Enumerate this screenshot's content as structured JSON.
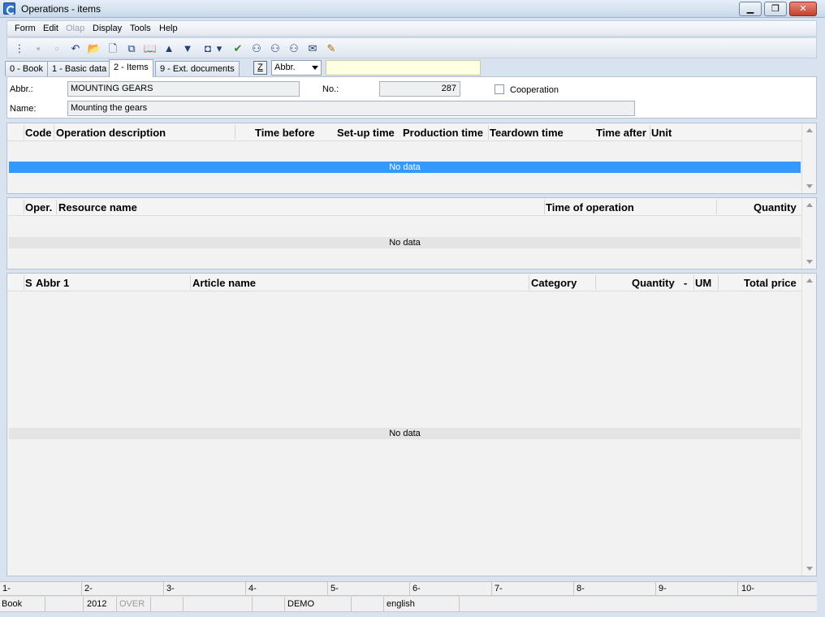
{
  "window": {
    "title": "Operations - items",
    "min": "▁",
    "max": "❐",
    "close": "✕"
  },
  "menu": [
    {
      "label": "Form",
      "disabled": false
    },
    {
      "label": "Edit",
      "disabled": false
    },
    {
      "label": "Olap",
      "disabled": true
    },
    {
      "label": "Display",
      "disabled": false
    },
    {
      "label": "Tools",
      "disabled": false
    },
    {
      "label": "Help",
      "disabled": false
    }
  ],
  "toolbar": [
    {
      "icon": "tree-icon",
      "glyph": "⋮"
    },
    {
      "icon": "save-icon",
      "glyph": "▪",
      "disabled": true
    },
    {
      "icon": "save-as-icon",
      "glyph": "▫",
      "disabled": true
    },
    {
      "icon": "undo-icon",
      "glyph": "↶"
    },
    {
      "icon": "open-folder-icon",
      "glyph": "📂"
    },
    {
      "icon": "new-document-icon",
      "glyph": "🗋"
    },
    {
      "icon": "copy-icon",
      "glyph": "⧉"
    },
    {
      "icon": "book-icon",
      "glyph": "📖"
    },
    {
      "icon": "arrow-up-icon",
      "glyph": "▲"
    },
    {
      "icon": "arrow-down-icon",
      "glyph": "▼"
    },
    {
      "icon": "camera-icon",
      "glyph": "◘"
    },
    {
      "icon": "dropdown-icon",
      "glyph": "▾"
    },
    {
      "icon": "filter-icon",
      "glyph": "✔"
    },
    {
      "icon": "binoculars-icon",
      "glyph": "⚇"
    },
    {
      "icon": "find-next-icon",
      "glyph": "⚇"
    },
    {
      "icon": "find-prev-icon",
      "glyph": "⚇"
    },
    {
      "icon": "mail-icon",
      "glyph": "✉"
    },
    {
      "icon": "notes-icon",
      "glyph": "✎"
    }
  ],
  "tabs": [
    {
      "label": "0 - Book",
      "active": false
    },
    {
      "label": "1 - Basic data",
      "active": false
    },
    {
      "label": "2 - Items",
      "active": true
    },
    {
      "label": "9 - Ext. documents",
      "active": false
    }
  ],
  "filter": {
    "z_label": "Z",
    "combo_value": "Abbr.",
    "search_value": ""
  },
  "form": {
    "abbr_label": "Abbr.:",
    "abbr_value": "MOUNTING GEARS",
    "no_label": "No.:",
    "no_value": "287",
    "cooperation_label": "Cooperation",
    "name_label": "Name:",
    "name_value": "Mounting the gears"
  },
  "grid1": {
    "headers": [
      "Code",
      "Operation description",
      "Time before",
      "Set-up time",
      "Production time",
      "Teardown time",
      "Time after",
      "Unit"
    ],
    "empty": "No data"
  },
  "grid2": {
    "headers": [
      "Oper.",
      "Resource name",
      "Time of operation",
      "Quantity"
    ],
    "empty": "No data"
  },
  "grid3": {
    "headers": [
      "S",
      "Abbr 1",
      "Article name",
      "Category",
      "Quantity",
      "-",
      "UM",
      "Total price"
    ],
    "empty": "No data"
  },
  "fkeys": [
    "1-",
    "2-",
    "3-",
    "4-",
    "5-",
    "6-",
    "7-",
    "8-",
    "9-",
    "10-"
  ],
  "status": {
    "mode": "Book",
    "year": "2012",
    "over": "OVER",
    "db": "DEMO",
    "lang": "english"
  }
}
